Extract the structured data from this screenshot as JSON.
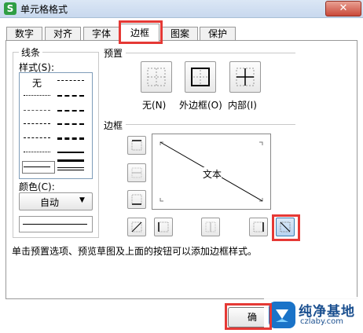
{
  "window": {
    "title": "单元格格式",
    "close_glyph": "✕",
    "app_icon_letter": "S"
  },
  "tabs": [
    {
      "label": "数字"
    },
    {
      "label": "对齐"
    },
    {
      "label": "字体"
    },
    {
      "label": "边框",
      "active": true
    },
    {
      "label": "图案"
    },
    {
      "label": "保护"
    }
  ],
  "line_group": {
    "title": "线条",
    "style_label": "样式(S):",
    "none_label": "无",
    "color_label": "颜色(C):",
    "color_value": "自动",
    "color_arrow": "▼"
  },
  "presets": {
    "title": "预置",
    "none": "无(N)",
    "outline": "外边框(O)",
    "inside": "内部(I)"
  },
  "border": {
    "title": "边框",
    "diagram_text": "文本"
  },
  "hint": "单击预置选项、预览草图及上面的按钮可以添加边框样式。",
  "ok_button": "确",
  "watermark": {
    "name": "纯净基地",
    "url": "czlaby.com"
  },
  "colors": {
    "highlight": "#e53935",
    "title_bar": "#c8d8ee",
    "close": "#c9493a"
  }
}
